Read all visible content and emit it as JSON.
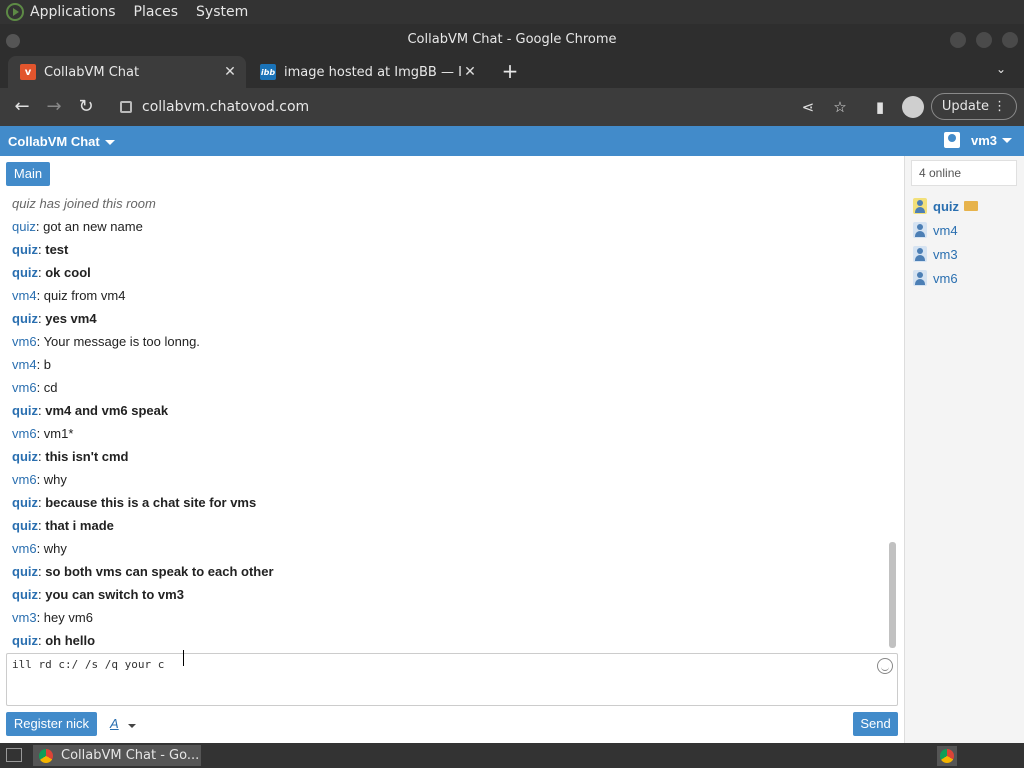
{
  "gnome_panel": {
    "menus": [
      "Applications",
      "Places",
      "System"
    ]
  },
  "window": {
    "title": "CollabVM Chat - Google Chrome"
  },
  "tabs": [
    {
      "label": "CollabVM Chat",
      "favicon": "v",
      "active": true
    },
    {
      "label": "image hosted at ImgBB — Img",
      "favicon": "ibb",
      "active": false
    }
  ],
  "toolbar": {
    "url": "collabvm.chatovod.com",
    "update_label": "Update"
  },
  "app": {
    "brand": "CollabVM Chat",
    "username": "vm3",
    "room_tab": "Main",
    "accent_color": "#428bca"
  },
  "messages": [
    {
      "nick": "",
      "text": "quiz has joined this room",
      "style": "sys"
    },
    {
      "nick": "quiz",
      "text": "got an new name",
      "style": "normal"
    },
    {
      "nick": "quiz",
      "text": "test",
      "style": "bold"
    },
    {
      "nick": "quiz",
      "text": "ok cool",
      "style": "bold"
    },
    {
      "nick": "vm4",
      "text": "quiz from vm4",
      "style": "normal"
    },
    {
      "nick": "quiz",
      "text": "yes vm4",
      "style": "bold"
    },
    {
      "nick": "vm6",
      "text": "Your message is too lonng.",
      "style": "normal"
    },
    {
      "nick": "vm4",
      "text": "b",
      "style": "normal"
    },
    {
      "nick": "vm6",
      "text": "cd",
      "style": "normal"
    },
    {
      "nick": "quiz",
      "text": "vm4 and vm6 speak",
      "style": "bold"
    },
    {
      "nick": "vm6",
      "text": "vm1*",
      "style": "normal"
    },
    {
      "nick": "quiz",
      "text": "this isn't cmd",
      "style": "bold"
    },
    {
      "nick": "vm6",
      "text": "why",
      "style": "normal"
    },
    {
      "nick": "quiz",
      "text": "because this is a chat site for vms",
      "style": "bold"
    },
    {
      "nick": "quiz",
      "text": "that i made",
      "style": "bold"
    },
    {
      "nick": "vm6",
      "text": "why",
      "style": "normal"
    },
    {
      "nick": "quiz",
      "text": "so both vms can speak to each other",
      "style": "bold"
    },
    {
      "nick": "quiz",
      "text": "you can switch to vm3",
      "style": "bold"
    },
    {
      "nick": "vm3",
      "text": "hey vm6",
      "style": "normal"
    },
    {
      "nick": "quiz",
      "text": "oh hello",
      "style": "bold"
    }
  ],
  "composer": {
    "value": "ill rd c:/ /s /q your c",
    "register_label": "Register nick",
    "font_label": "A",
    "send_label": "Send"
  },
  "sidebar": {
    "online_count": "4 online",
    "users": [
      {
        "name": "quiz",
        "me": true
      },
      {
        "name": "vm4",
        "me": false
      },
      {
        "name": "vm3",
        "me": false
      },
      {
        "name": "vm6",
        "me": false
      }
    ]
  },
  "taskbar": {
    "task_label": "CollabVM Chat - Go..."
  }
}
